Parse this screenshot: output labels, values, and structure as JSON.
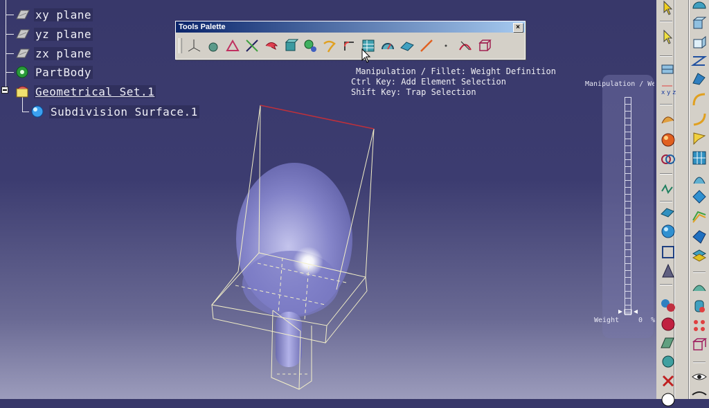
{
  "tree": {
    "items": [
      {
        "label": "xy plane",
        "icon": "plane-icon"
      },
      {
        "label": "yz plane",
        "icon": "plane-icon"
      },
      {
        "label": "zx plane",
        "icon": "plane-icon"
      },
      {
        "label": "PartBody",
        "icon": "gear-icon"
      },
      {
        "label": "Geometrical Set.1",
        "icon": "geometrical-set-icon"
      },
      {
        "label": "Subdivision Surface.1",
        "icon": "subdivision-surface-icon"
      }
    ]
  },
  "palette": {
    "title": "Tools Palette",
    "close": "×"
  },
  "hint": {
    "line1": "Manipulation / Fillet: Weight Definition",
    "line2": "Ctrl Key: Add Element Selection",
    "line3": "Shift Key: Trap Selection"
  },
  "slider": {
    "title": "Manipulation / Weight",
    "label": "Weight",
    "value": "0",
    "unit": "%"
  },
  "colors": {
    "background_top": "#38386a",
    "background_bottom": "#9c9cbc",
    "wireframe": "#f4f0c8",
    "edge_highlight": "#c0303a",
    "surface": "#9c9ce0"
  }
}
